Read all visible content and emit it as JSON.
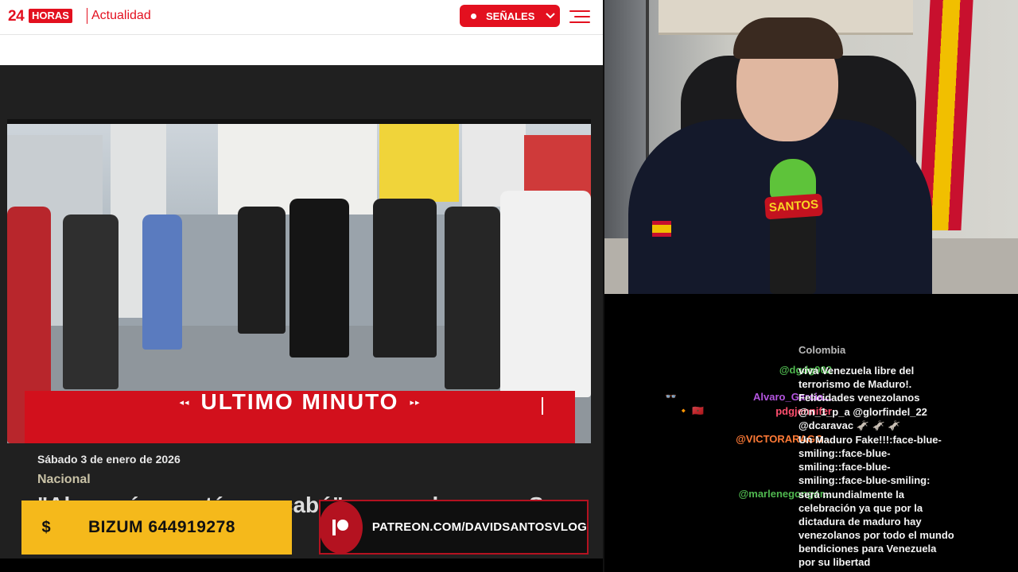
{
  "site": {
    "logo_number": "24",
    "logo_word": "HORAS",
    "section": "Actualidad",
    "signals_button": "SEÑALES",
    "breaking_banner": "ULTIMO MINUTO",
    "article_date": "Sábado 3 de enero de 2026",
    "article_category": "Nacional",
    "article_headline": "\"Ahora sí, ya está, se acabó\": venezolanos en Sa"
  },
  "overlays": {
    "bizum_icon": "$",
    "bizum_text": "BIZUM 644919278",
    "patreon_text": "PATREON.COM/DAVIDSANTOSVLOG"
  },
  "webcam": {
    "mic_brand": "SANTOS"
  },
  "chat": {
    "messages": [
      {
        "user": "",
        "badges": "",
        "lines": [
          "Colombia"
        ]
      },
      {
        "user": "@dgdg902",
        "user_color": "#4fb84f",
        "badges": "",
        "lines": [
          "viva Venezuela libre del",
          "terrorismo de Maduro!."
        ]
      },
      {
        "user": "Alvaro_Garcia...",
        "user_color": "#b455e0",
        "badges": "👓",
        "lines": [
          "Felicidades venezolanos"
        ]
      },
      {
        "user": "pdgjennifer",
        "user_color": "#ff4f6e",
        "badges": "🔸 🇲🇦",
        "lines": [
          "@n_1_p_a @glorfindel_22",
          "@dcaravac 🫏 🫏 🫏"
        ]
      },
      {
        "user": "@VICTORARAGO...",
        "user_color": "#ff7a36",
        "badges": "",
        "lines": [
          "Un Maduro Fake!!!:face-blue-",
          "smiling::face-blue-",
          "smiling::face-blue-",
          "smiling::face-blue-smiling:"
        ]
      },
      {
        "user": "@marlenegongor...",
        "user_color": "#4fb84f",
        "badges": "",
        "lines": [
          "será mundialmente la",
          "celebración ya que por la",
          "dictadura de maduro hay",
          "venezolanos por todo el mundo",
          "bendiciones para Venezuela",
          "por su libertad"
        ]
      }
    ]
  },
  "colors": {
    "brand_red": "#e3101f",
    "bizum_yellow": "#f5b91b",
    "patreon_red": "#b41220"
  }
}
